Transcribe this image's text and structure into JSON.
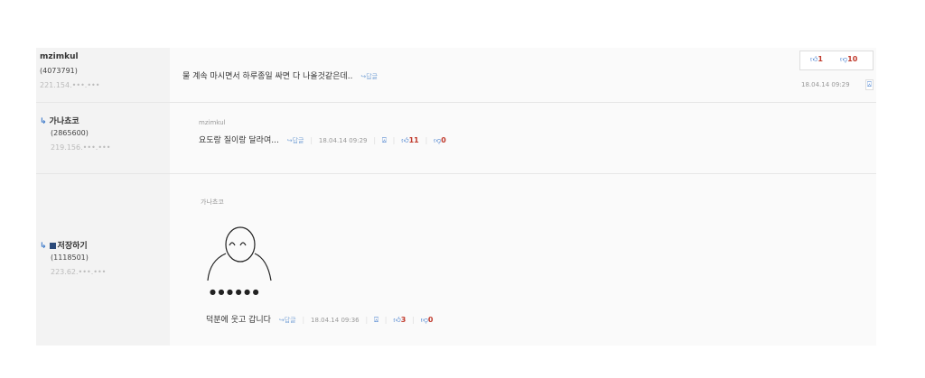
{
  "comments": [
    {
      "nickname": "mzimkul",
      "user_id": "(4073791)",
      "ip": "221.154.•••.•••",
      "text": "물 계속 마시면서 하루종일 싸면 다 나올것같은데..",
      "reply_label": "↪답글",
      "up_count": "1",
      "down_count": "10",
      "timestamp": "18.04.14 09:29"
    },
    {
      "nickname": "가나쵸코",
      "user_id": "(2865600)",
      "ip": "219.156.•••.•••",
      "quoted_author": "mzimkul",
      "text": "요도랑 질이랑 달라여...",
      "reply_label": "↪답글",
      "timestamp": "18.04.14 09:29",
      "up_count": "11",
      "down_count": "0"
    },
    {
      "nickname": "저장하기",
      "user_id": "(1118501)",
      "ip": "223.62.•••.•••",
      "quoted_author": "가나쵸코",
      "dots": "● ● ● ● ● ●",
      "text": "덕분에 웃고 갑니다",
      "reply_label": "↪답글",
      "timestamp": "18.04.14 09:36",
      "up_count": "3",
      "down_count": "0"
    }
  ],
  "icons": {
    "thumb_up": "thumbs-up-icon",
    "thumb_down": "thumbs-down-icon",
    "report": "report-icon",
    "reply_arrow": "reply-arrow-icon",
    "save": "save-icon"
  },
  "colors": {
    "author_bg": "#f3f3f3",
    "content_bg": "#fafafa",
    "accent": "#2f6fc8",
    "count_red": "#c0392b"
  }
}
